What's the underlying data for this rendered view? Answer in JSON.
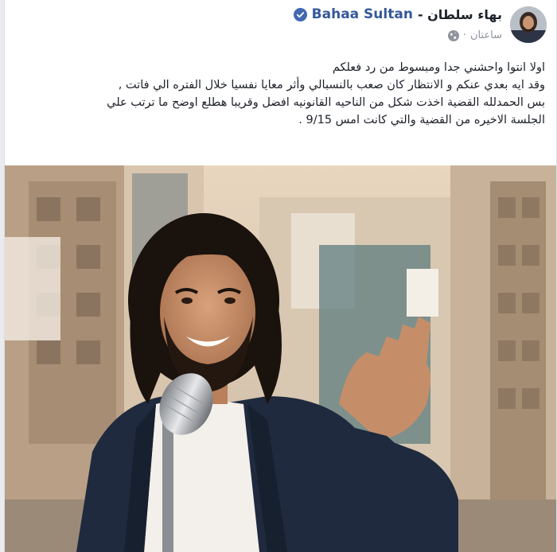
{
  "post": {
    "author_ar": "بهاء سلطان -",
    "author_en": "Bahaa Sultan",
    "time": "ساعتان",
    "separator": "·",
    "lines": [
      "اولا انتوا واحشني جدا ومبسوط من رد فعلكم",
      "وقد ايه بعدي عنكم و الانتظار كان صعب بالنسبالي وأثر معايا نفسيا خلال الفتره الي فاتت ,",
      "بس الحمدلله القضية اخذت شكل من الناحيه القانونيه افضل وقريبا هطلع اوضح ما ترتب علي",
      "الجلسة الاخيره من القضية والتي كانت امس 9/15 ."
    ]
  },
  "icons": {
    "verified": "verified-badge-icon",
    "privacy": "globe-icon"
  },
  "colors": {
    "name_link": "#365899",
    "verified": "#4267b2",
    "meta_gray": "#90949c",
    "text": "#1d2129"
  }
}
